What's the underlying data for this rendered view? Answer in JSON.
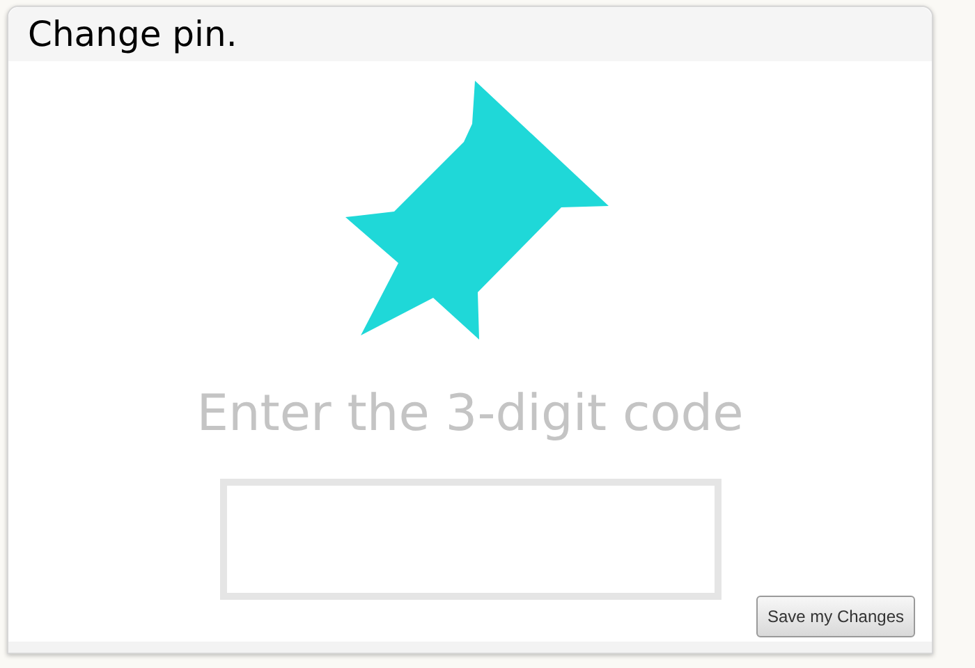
{
  "dialog": {
    "title": "Change pin.",
    "prompt": "Enter the 3-digit code",
    "buttons": [
      {
        "label": "Save my Changes",
        "kind": "primary"
      }
    ]
  }
}
